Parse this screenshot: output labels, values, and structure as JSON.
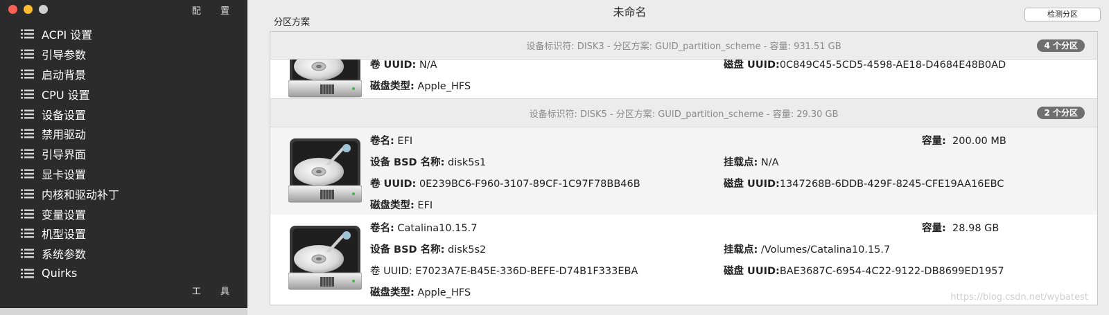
{
  "sidebar": {
    "title": "配 置",
    "tools": "工 具",
    "items": [
      {
        "label": "ACPI 设置",
        "icon": "list-icon"
      },
      {
        "label": "引导参数",
        "icon": "list-icon"
      },
      {
        "label": "启动背景",
        "icon": "list-icon"
      },
      {
        "label": "CPU 设置",
        "icon": "list-icon"
      },
      {
        "label": "设备设置",
        "icon": "list-icon"
      },
      {
        "label": "禁用驱动",
        "icon": "list-icon"
      },
      {
        "label": "引导界面",
        "icon": "list-icon"
      },
      {
        "label": "显卡设置",
        "icon": "list-icon"
      },
      {
        "label": "内核和驱动补丁",
        "icon": "list-icon"
      },
      {
        "label": "变量设置",
        "icon": "list-icon"
      },
      {
        "label": "机型设置",
        "icon": "list-icon"
      },
      {
        "label": "系统参数",
        "icon": "list-icon"
      },
      {
        "label": "Quirks",
        "icon": "list-icon"
      }
    ]
  },
  "window": {
    "title": "未命名"
  },
  "section_label": "分区方案",
  "detect_button": "检测分区",
  "disks": [
    {
      "header": "设备标识符: DISK3 - 分区方案: GUID_partition_scheme - 容量: 931.51 GB",
      "badge": "4 个分区",
      "partitions": [
        {
          "vol_uuid_label": "卷 UUID:",
          "vol_uuid": "N/A",
          "disk_uuid_label": "磁盘 UUID:",
          "disk_uuid": "0C849C45-5CD5-4598-AE18-D4684E48B0AD",
          "type_label": "磁盘类型:",
          "type": "Apple_HFS"
        }
      ]
    },
    {
      "header": "设备标识符: DISK5 - 分区方案: GUID_partition_scheme - 容量: 29.30 GB",
      "badge": "2 个分区",
      "partitions": [
        {
          "name_label": "卷名:",
          "name": "EFI",
          "capacity_label": "容量:",
          "capacity": "200.00 MB",
          "bsd_label": "设备 BSD 名称:",
          "bsd": "disk5s1",
          "mount_label": "挂载点:",
          "mount": "N/A",
          "vol_uuid_label": "卷 UUID:",
          "vol_uuid": "0E239BC6-F960-3107-89CF-1C97F78BB46B",
          "disk_uuid_label": "磁盘 UUID:",
          "disk_uuid": "1347268B-6DDB-429F-8245-CFE19AA16EBC",
          "type_label": "磁盘类型:",
          "type": "EFI"
        },
        {
          "name_label": "卷名:",
          "name": "Catalina10.15.7",
          "capacity_label": "容量:",
          "capacity": "28.98 GB",
          "bsd_label": "设备 BSD 名称:",
          "bsd": "disk5s2",
          "mount_label": "挂载点:",
          "mount": "/Volumes/Catalina10.15.7",
          "vol_uuid_label": "卷 UUID:",
          "vol_uuid": "E7023A7E-B45E-336D-BEFE-D74B1F333EBA",
          "disk_uuid_label": "磁盘 UUID:",
          "disk_uuid": "BAE3687C-6954-4C22-9122-DB8699ED1957",
          "type_label": "磁盘类型:",
          "type": "Apple_HFS"
        }
      ]
    }
  ],
  "watermark": "https://blog.csdn.net/wybatest",
  "colors": {
    "sidebar_bg": "#2b2b2b",
    "badge_bg": "#6f6f6f",
    "header_text": "#8a8a8a"
  }
}
